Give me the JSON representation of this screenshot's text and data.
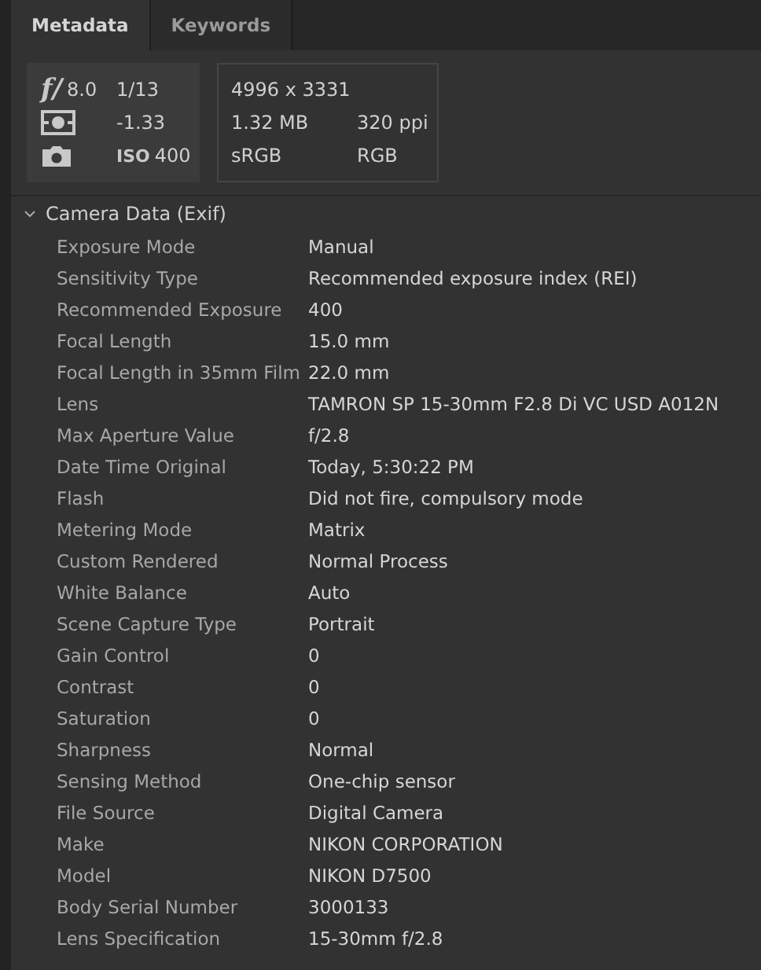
{
  "tabs": [
    {
      "label": "Metadata",
      "selected": true
    },
    {
      "label": "Keywords",
      "selected": false
    }
  ],
  "summary": {
    "aperture_mark": "f/",
    "aperture": "8.0",
    "shutter": "1/13",
    "exposure_bias": "-1.33",
    "iso_mark": "ISO",
    "iso": "400",
    "dimensions": "4996 x 3331",
    "file_size": "1.32 MB",
    "resolution": "320 ppi",
    "color_profile": "sRGB",
    "color_mode": "RGB"
  },
  "section": {
    "title": "Camera Data (Exif)",
    "expanded": true,
    "rows": [
      {
        "label": "Exposure Mode",
        "value": "Manual"
      },
      {
        "label": "Sensitivity Type",
        "value": "Recommended exposure index (REI)"
      },
      {
        "label": "Recommended Exposure",
        "value": "400"
      },
      {
        "label": "Focal Length",
        "value": "15.0 mm"
      },
      {
        "label": "Focal Length in 35mm Film",
        "value": "22.0 mm"
      },
      {
        "label": "Lens",
        "value": "TAMRON SP 15-30mm F2.8 Di VC USD A012N"
      },
      {
        "label": "Max Aperture Value",
        "value": "f/2.8"
      },
      {
        "label": "Date Time Original",
        "value": "Today, 5:30:22 PM"
      },
      {
        "label": "Flash",
        "value": "Did not fire, compulsory mode"
      },
      {
        "label": "Metering Mode",
        "value": "Matrix"
      },
      {
        "label": "Custom Rendered",
        "value": "Normal Process"
      },
      {
        "label": "White Balance",
        "value": "Auto"
      },
      {
        "label": "Scene Capture Type",
        "value": "Portrait"
      },
      {
        "label": "Gain Control",
        "value": "0"
      },
      {
        "label": "Contrast",
        "value": "0"
      },
      {
        "label": "Saturation",
        "value": "0"
      },
      {
        "label": "Sharpness",
        "value": "Normal"
      },
      {
        "label": "Sensing Method",
        "value": "One-chip sensor"
      },
      {
        "label": "File Source",
        "value": "Digital Camera"
      },
      {
        "label": "Make",
        "value": "NIKON CORPORATION"
      },
      {
        "label": "Model",
        "value": "NIKON D7500"
      },
      {
        "label": "Body Serial Number",
        "value": "3000133"
      },
      {
        "label": "Lens Specification",
        "value": "15-30mm f/2.8"
      }
    ]
  }
}
